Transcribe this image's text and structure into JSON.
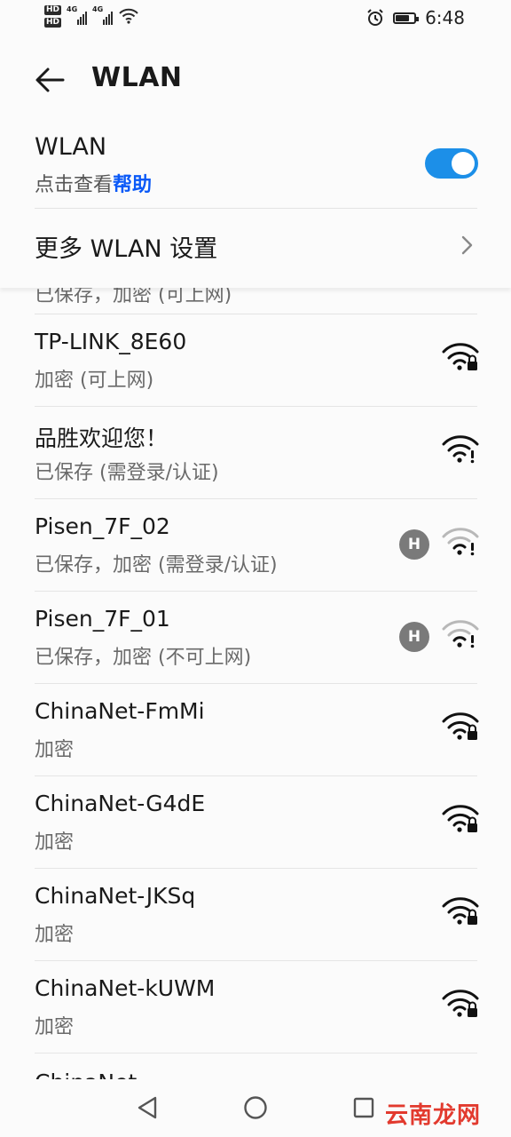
{
  "status_bar": {
    "hd_badges": [
      "HD",
      "HD"
    ],
    "signal_labels": [
      "4G",
      "4G"
    ],
    "time": "6:48",
    "icons": [
      "hd-icon",
      "signal-4g-icon",
      "signal-4g-icon",
      "wifi-icon",
      "alarm-icon",
      "battery-icon"
    ]
  },
  "app_bar": {
    "title": "WLAN",
    "back_icon": "arrow-left-icon"
  },
  "wlan_toggle": {
    "label": "WLAN",
    "hint_prefix": "点击查看",
    "hint_link": "帮助",
    "state": "on",
    "accent": "#1c8fe8"
  },
  "more_settings": {
    "label": "更多 WLAN 设置",
    "icon": "chevron-right-icon"
  },
  "networks_partial_top": {
    "status": "已保存，加密 (可上网)"
  },
  "networks": [
    {
      "name": "TP-LINK_8E60",
      "status": "加密 (可上网)",
      "icon": "wifi-lock-icon"
    },
    {
      "name": "品胜欢迎您！",
      "status": "已保存 (需登录/认证)",
      "icon": "wifi-exclamation-icon"
    },
    {
      "name": "Pisen_7F_02",
      "status": "已保存，加密 (需登录/认证)",
      "icon": "wifi-exclamation-weak-icon",
      "badge": "H"
    },
    {
      "name": "Pisen_7F_01",
      "status": "已保存，加密 (不可上网)",
      "icon": "wifi-exclamation-weak-icon",
      "badge": "H"
    },
    {
      "name": "ChinaNet-FmMi",
      "status": "加密",
      "icon": "wifi-lock-icon"
    },
    {
      "name": "ChinaNet-G4dE",
      "status": "加密",
      "icon": "wifi-lock-icon"
    },
    {
      "name": "ChinaNet-JKSq",
      "status": "加密",
      "icon": "wifi-lock-icon"
    },
    {
      "name": "ChinaNet-kUWM",
      "status": "加密",
      "icon": "wifi-lock-icon"
    }
  ],
  "networks_partial_bottom": {
    "name": "ChinaNet-"
  },
  "nav_bar": {
    "buttons": [
      "back-triangle-icon",
      "home-circle-icon",
      "recents-square-icon"
    ]
  },
  "watermark": "云南龙网"
}
